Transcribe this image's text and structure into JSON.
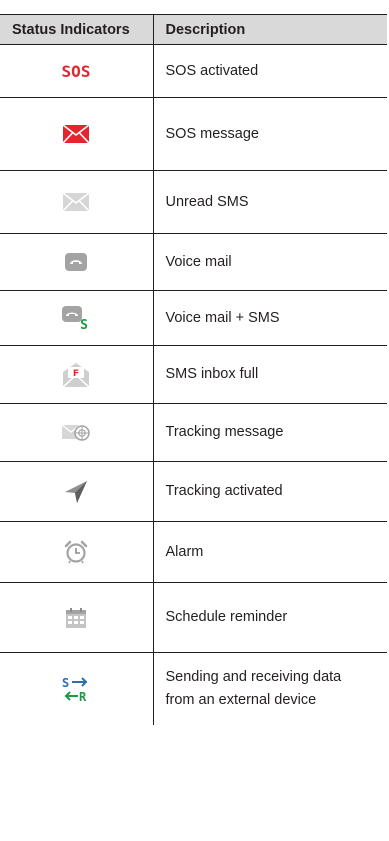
{
  "table": {
    "headers": [
      "Status Indicators",
      "Description"
    ],
    "rows": [
      {
        "icon": "sos-icon",
        "text": "SOS activated",
        "icon_text": "SOS"
      },
      {
        "icon": "sos-message-icon",
        "text": "SOS message"
      },
      {
        "icon": "unread-sms-icon",
        "text": "Unread SMS"
      },
      {
        "icon": "voice-mail-icon",
        "text": "Voice mail"
      },
      {
        "icon": "voice-mail-sms-icon",
        "text": "Voice mail + SMS",
        "icon_text": "S"
      },
      {
        "icon": "sms-inbox-full-icon",
        "text": "SMS inbox full",
        "icon_text": "F"
      },
      {
        "icon": "tracking-message-icon",
        "text": "Tracking message"
      },
      {
        "icon": "tracking-activated-icon",
        "text": "Tracking activated"
      },
      {
        "icon": "alarm-icon",
        "text": "Alarm"
      },
      {
        "icon": "schedule-reminder-icon",
        "text": "Schedule reminder"
      },
      {
        "icon": "data-transfer-icon",
        "text": "Sending and receiving data from an external device",
        "icon_text_send": "S",
        "icon_text_receive": "R"
      }
    ]
  },
  "colors": {
    "header_bg": "#d9d9d9",
    "border": "#231f20",
    "sos_red": "#e3262d",
    "icon_gray": "#a3a3a3",
    "green": "#1d9a45",
    "blue": "#2e6db4"
  }
}
